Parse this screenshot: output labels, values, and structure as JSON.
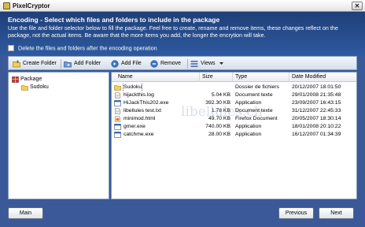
{
  "window": {
    "title": "PixelCryptor"
  },
  "header": {
    "title": "Encoding - Select which files and folders to include in the package",
    "description": "Use the file and folder selector below to fill the package. Feel free to create, rename and remove items, these changes reflect on the package, not the actual items. Be aware that the more items you add, the longer the encrytion will take.",
    "delete_checkbox_label": "Delete the files and folders after the encoding operation",
    "delete_checked": false
  },
  "toolbar": {
    "create_folder": "Create Folder",
    "add_folder": "Add Folder",
    "add_file": "Add File",
    "remove": "Remove",
    "views": "Views"
  },
  "tree": {
    "root": "Package",
    "child": "Sudoku"
  },
  "list": {
    "columns": [
      "Name",
      "Size",
      "Type",
      "Date Modified"
    ],
    "rows": [
      {
        "name": "Sudoku",
        "size": "",
        "type": "Dossier de fichiers",
        "date": "20/12/2007 18:01:50",
        "icon": "folder-icon"
      },
      {
        "name": "hijackthis.log",
        "size": "5.04 KB",
        "type": "Document texte",
        "date": "29/01/2008 21:35:48",
        "icon": "text-file-icon"
      },
      {
        "name": "HiJackThis202.exe",
        "size": "392.30 KB",
        "type": "Application",
        "date": "23/09/2007 16:43:15",
        "icon": "exe-file-icon"
      },
      {
        "name": "libellules test.txt",
        "size": "1.78 KB",
        "type": "Document texte",
        "date": "31/12/2007 22:45:33",
        "icon": "text-file-icon"
      },
      {
        "name": "minimod.html",
        "size": "49.70 KB",
        "type": "Firefox Document",
        "date": "20/05/2007 18:30:14",
        "icon": "html-file-icon"
      },
      {
        "name": "gmer.exe",
        "size": "740.00 KB",
        "type": "Application",
        "date": "18/01/2008 20:10:22",
        "icon": "exe-file-icon"
      },
      {
        "name": "catchme.exe",
        "size": "28.00 KB",
        "type": "Application",
        "date": "16/12/2007 01:34:39",
        "icon": "exe-file-icon"
      }
    ]
  },
  "watermark": "libellules.ch",
  "buttons": {
    "main": "Main",
    "previous": "Previous",
    "next": "Next"
  }
}
